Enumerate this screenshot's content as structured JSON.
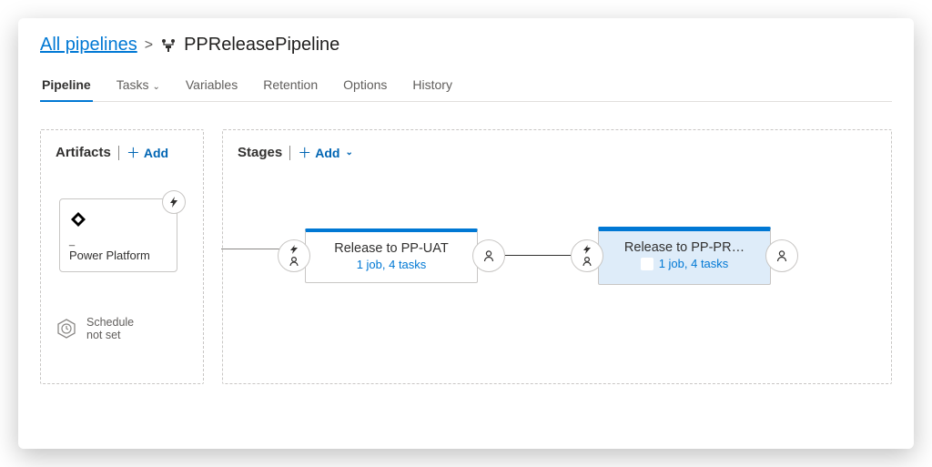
{
  "breadcrumb": {
    "root": "All pipelines",
    "title": "PPReleasePipeline"
  },
  "tabs": {
    "pipeline": "Pipeline",
    "tasks": "Tasks",
    "variables": "Variables",
    "retention": "Retention",
    "options": "Options",
    "history": "History"
  },
  "artifacts": {
    "header": "Artifacts",
    "add": "Add",
    "card": {
      "dash": "_",
      "name": "Power Platform"
    },
    "schedule": "Schedule\nnot set"
  },
  "stages": {
    "header": "Stages",
    "add": "Add",
    "items": [
      {
        "name": "Release to PP-UAT",
        "sub": "1 job, 4 tasks",
        "selected": false
      },
      {
        "name": "Release to PP-PR…",
        "sub": "1 job, 4 tasks",
        "selected": true
      }
    ]
  }
}
